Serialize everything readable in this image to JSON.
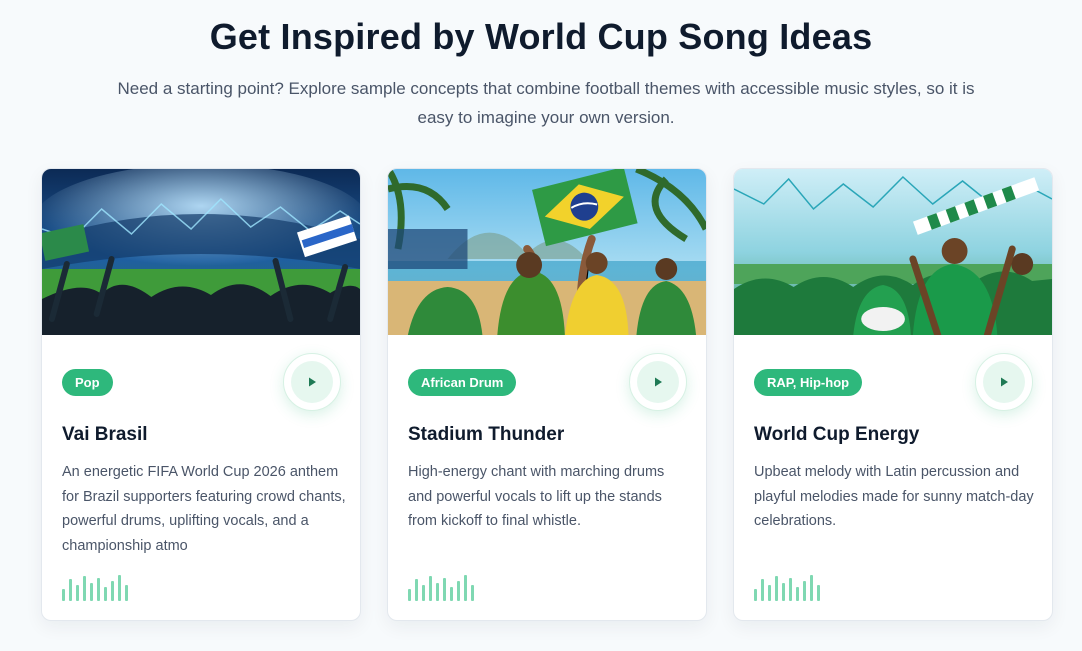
{
  "header": {
    "title": "Get Inspired by World Cup Song Ideas",
    "subtitle": "Need a starting point? Explore sample concepts that combine football themes with accessible music styles, so it is easy to imagine your own version."
  },
  "colors": {
    "accent": "#2eb87c",
    "title_text": "#0f1b2d",
    "body_text": "#4a5568"
  },
  "cards": [
    {
      "genre": "Pop",
      "title": "Vai Brasil",
      "description": "An energetic FIFA World Cup 2026 anthem for Brazil supporters featuring crowd chants, powerful drums, uplifting vocals, and a championship atmo",
      "image": "stadium-crowd-night",
      "play_icon": "play-icon",
      "wave_icon": "waveform-icon"
    },
    {
      "genre": "African Drum",
      "title": "Stadium Thunder",
      "description": "High-energy chant with marching drums and powerful vocals to lift up the stands from kickoff to final whistle.",
      "image": "beach-fans-brazil-flag",
      "play_icon": "play-icon",
      "wave_icon": "waveform-icon"
    },
    {
      "genre": "RAP, Hip-hop",
      "title": "World Cup Energy",
      "description": "Upbeat melody with Latin percussion and playful melodies made for sunny match-day celebrations.",
      "image": "green-fans-scarves",
      "play_icon": "play-icon",
      "wave_icon": "waveform-icon"
    }
  ]
}
